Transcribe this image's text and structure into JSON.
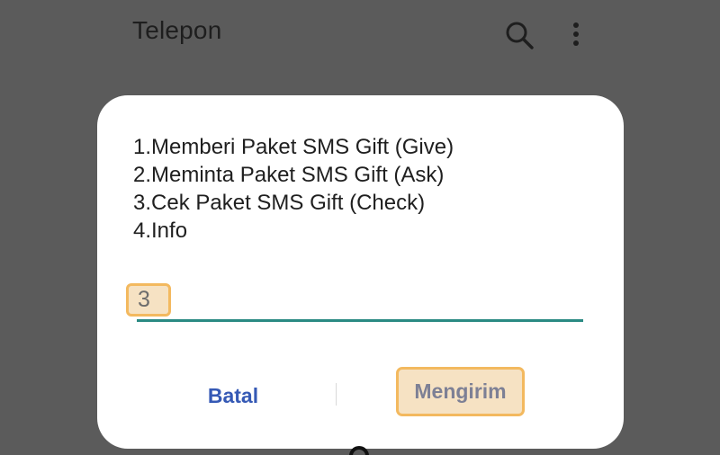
{
  "appbar": {
    "title": "Telepon",
    "icons": [
      "search-icon",
      "more-vert-icon"
    ]
  },
  "dialog": {
    "lines": [
      "1.Memberi Paket SMS Gift (Give)",
      "2.Meminta Paket SMS Gift (Ask)",
      "3.Cek Paket SMS Gift (Check)",
      "4.Info"
    ],
    "input_value": "3",
    "cancel_label": "Batal",
    "send_label": "Mengirim"
  },
  "colors": {
    "background": "#5b5b5b",
    "underline": "#2a8a83",
    "cancel_text": "#3559b5",
    "highlight_fill": "#f6e2c3",
    "highlight_border": "#f3b95f"
  }
}
